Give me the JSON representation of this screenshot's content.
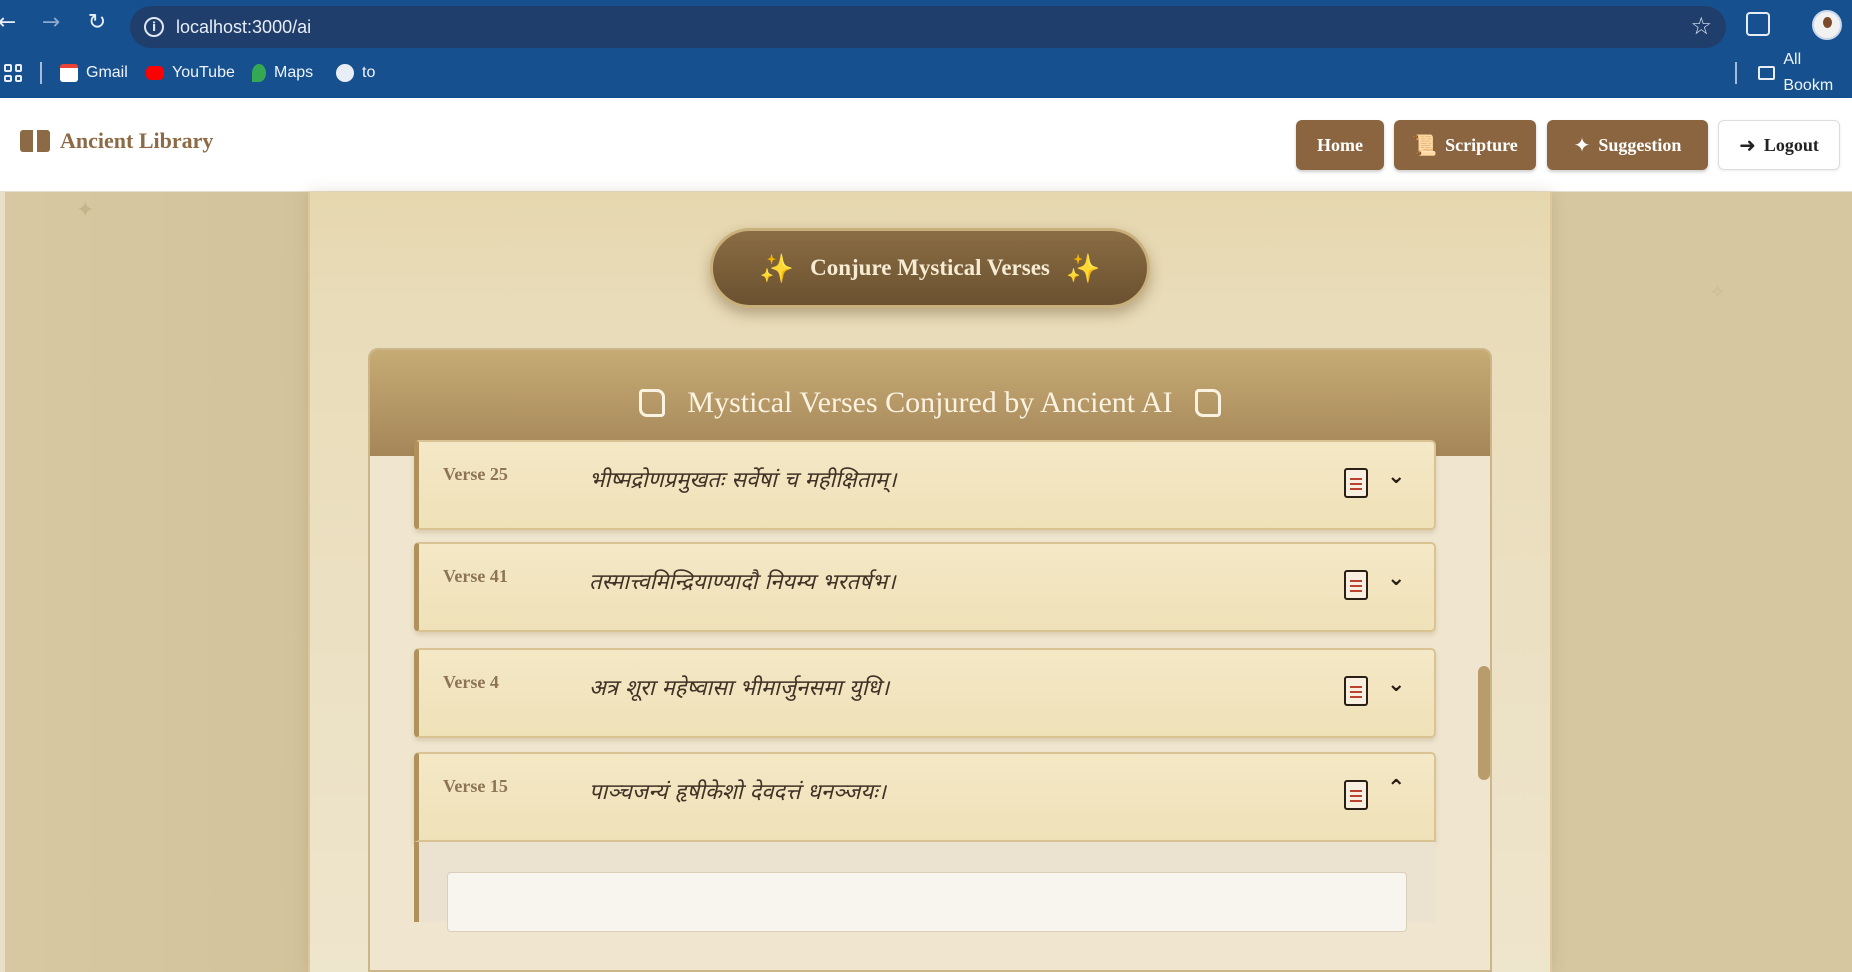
{
  "browser": {
    "url": "localhost:3000/ai",
    "bookmarks": [
      {
        "label": "Gmail",
        "icon": "gmail-icon",
        "color": "#ea4335"
      },
      {
        "label": "YouTube",
        "icon": "youtube-icon",
        "color": "#ff0000"
      },
      {
        "label": "Maps",
        "icon": "maps-icon",
        "color": "#34a853"
      },
      {
        "label": "to",
        "icon": "globe-icon",
        "color": "#e9eef6"
      }
    ],
    "all_bookmarks": "All Bookm"
  },
  "header": {
    "brand": "Ancient Library",
    "nav": {
      "home": "Home",
      "scripture": "Scripture",
      "suggestion": "Suggestion",
      "logout": "Logout"
    }
  },
  "main": {
    "conjure_button": "Conjure Mystical Verses",
    "panel_title": "Mystical Verses Conjured by Ancient AI",
    "verses": [
      {
        "label": "Verse 25",
        "text": "भीष्मद्रोणप्रमुखतः सर्वेषां च महीक्षिताम्।",
        "expanded": false
      },
      {
        "label": "Verse 41",
        "text": "तस्मात्त्वमिन्द्रियाण्यादौ नियम्य भरतर्षभ।",
        "expanded": false
      },
      {
        "label": "Verse 4",
        "text": "अत्र शूरा महेष्वासा भीमार्जुनसमा युधि।",
        "expanded": false
      },
      {
        "label": "Verse 15",
        "text": "पाञ्चजन्यं हृषीकेशो देवदत्तं धनञ्जयः।",
        "expanded": true
      }
    ]
  },
  "colors": {
    "accent": "#8a6540",
    "browser_bar": "#16508f",
    "panel_header": "#b59668"
  }
}
